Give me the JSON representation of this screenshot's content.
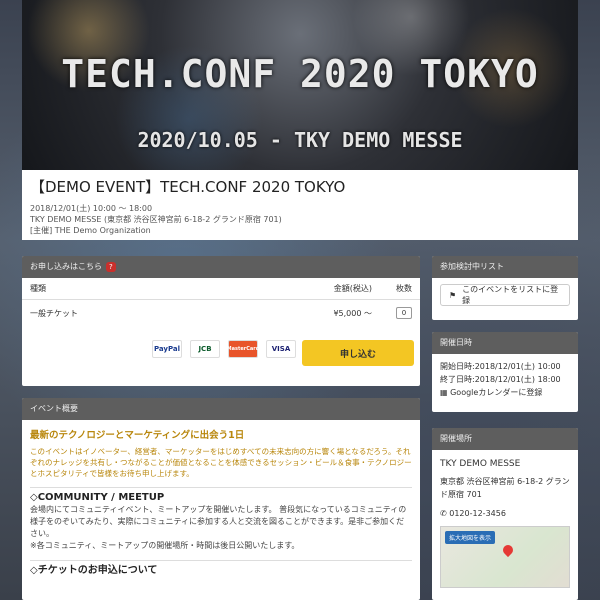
{
  "hero": {
    "title": "TECH.CONF 2020 TOKYO",
    "subtitle": "2020/10.05 - TKY DEMO MESSE"
  },
  "event": {
    "title": "【DEMO EVENT】TECH.CONF 2020 TOKYO",
    "date": "2018/12/01(土) 10:00 〜 18:00",
    "venue": "TKY DEMO MESSE (東京都 渋谷区神宮前 6-18-2 グランド原宿 701)",
    "organizer": "[主催] THE Demo Organization"
  },
  "ticket": {
    "header": "お申し込みはこちら",
    "help": "?",
    "col_type": "種類",
    "col_price": "金額(税込)",
    "col_qty": "枚数",
    "row_type": "一般チケット",
    "row_price": "¥5,000 〜",
    "row_qty": "0",
    "apply": "申し込む",
    "cards": [
      "PayPal",
      "JCB",
      "MasterCard",
      "VISA"
    ]
  },
  "overview": {
    "header": "イベント概要",
    "lead": "最新のテクノロジーとマーケティングに出会う1日",
    "desc": "このイベントはイノベーター、経営者、マーケッターをはじめすべての未来志向の方に響く場となるだろう。それぞれのナレッジを共有し・つながることが価値となることを体感できるセッション・ビール＆食事・テクノロジーとホスピタリティで皆様をお待ち申し上げます。",
    "community_title": "◇COMMUNITY / MEETUP",
    "community_text": "会場内にてコミュニティイベント、ミートアップを開催いたします。 普段気になっているコミュニティの様子をのぞいてみたり、実際にコミュニティに参加する人と交流を図ることができます。是非ご参加ください。",
    "community_note": "※各コミュニティ、ミートアップの開催場所・時間は後日公開いたします。",
    "ticket_title": "◇チケットのお申込について"
  },
  "watch": {
    "header": "参加検討中リスト",
    "button": "このイベントをリストに登録"
  },
  "dates": {
    "header": "開催日時",
    "start": "開始日時:2018/12/01(土) 10:00",
    "end": "終了日時:2018/12/01(土) 18:00",
    "calendar": "Googleカレンダーに登録"
  },
  "place": {
    "header": "開催場所",
    "name": "TKY DEMO MESSE",
    "address": "東京都 渋谷区神宮前 6-18-2 グランド原宿 701",
    "phone": "0120-12-3456",
    "map_button": "拡大地図を表示"
  }
}
